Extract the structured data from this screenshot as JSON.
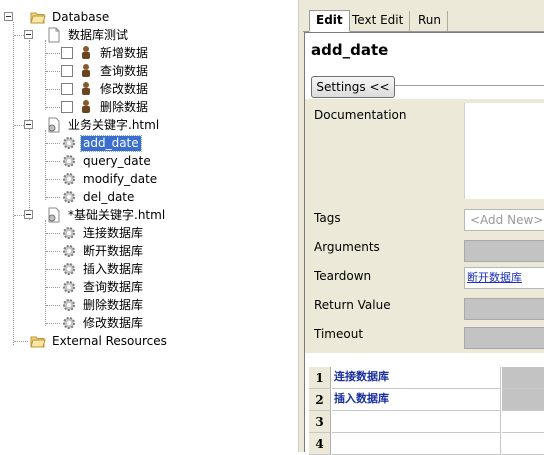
{
  "tree": {
    "root": "Database",
    "suite_folder": "数据库测试",
    "suite_tests": [
      "新增数据",
      "查询数据",
      "修改数据",
      "删除数据"
    ],
    "resource1": "业务关键字.html",
    "resource1_keywords": [
      "add_date",
      "query_date",
      "modify_date",
      "del_date"
    ],
    "selected_keyword": "add_date",
    "resource2": "*基础关键字.html",
    "resource2_keywords": [
      "连接数据库",
      "断开数据库",
      "插入数据库",
      "查询数据库",
      "删除数据库",
      "修改数据库"
    ],
    "external": "External Resources"
  },
  "tabs": [
    "Edit",
    "Text Edit",
    "Run"
  ],
  "active_tab": "Edit",
  "editor": {
    "keyword_name": "add_date",
    "settings_button": "Settings <<",
    "labels": {
      "documentation": "Documentation",
      "tags": "Tags",
      "arguments": "Arguments",
      "teardown": "Teardown",
      "return_value": "Return Value",
      "timeout": "Timeout"
    },
    "tags_placeholder": "<Add New>",
    "teardown_value": "断开数据库"
  },
  "grid": {
    "row_numbers": [
      "1",
      "2",
      "3",
      "4"
    ],
    "cells": [
      "连接数据库",
      "插入数据库",
      "",
      ""
    ]
  },
  "colors": {
    "selection": "#3a6fd0",
    "link": "#1a2fc0",
    "keyword_cell": "#1a2fa0",
    "panel": "#ece9d8"
  }
}
